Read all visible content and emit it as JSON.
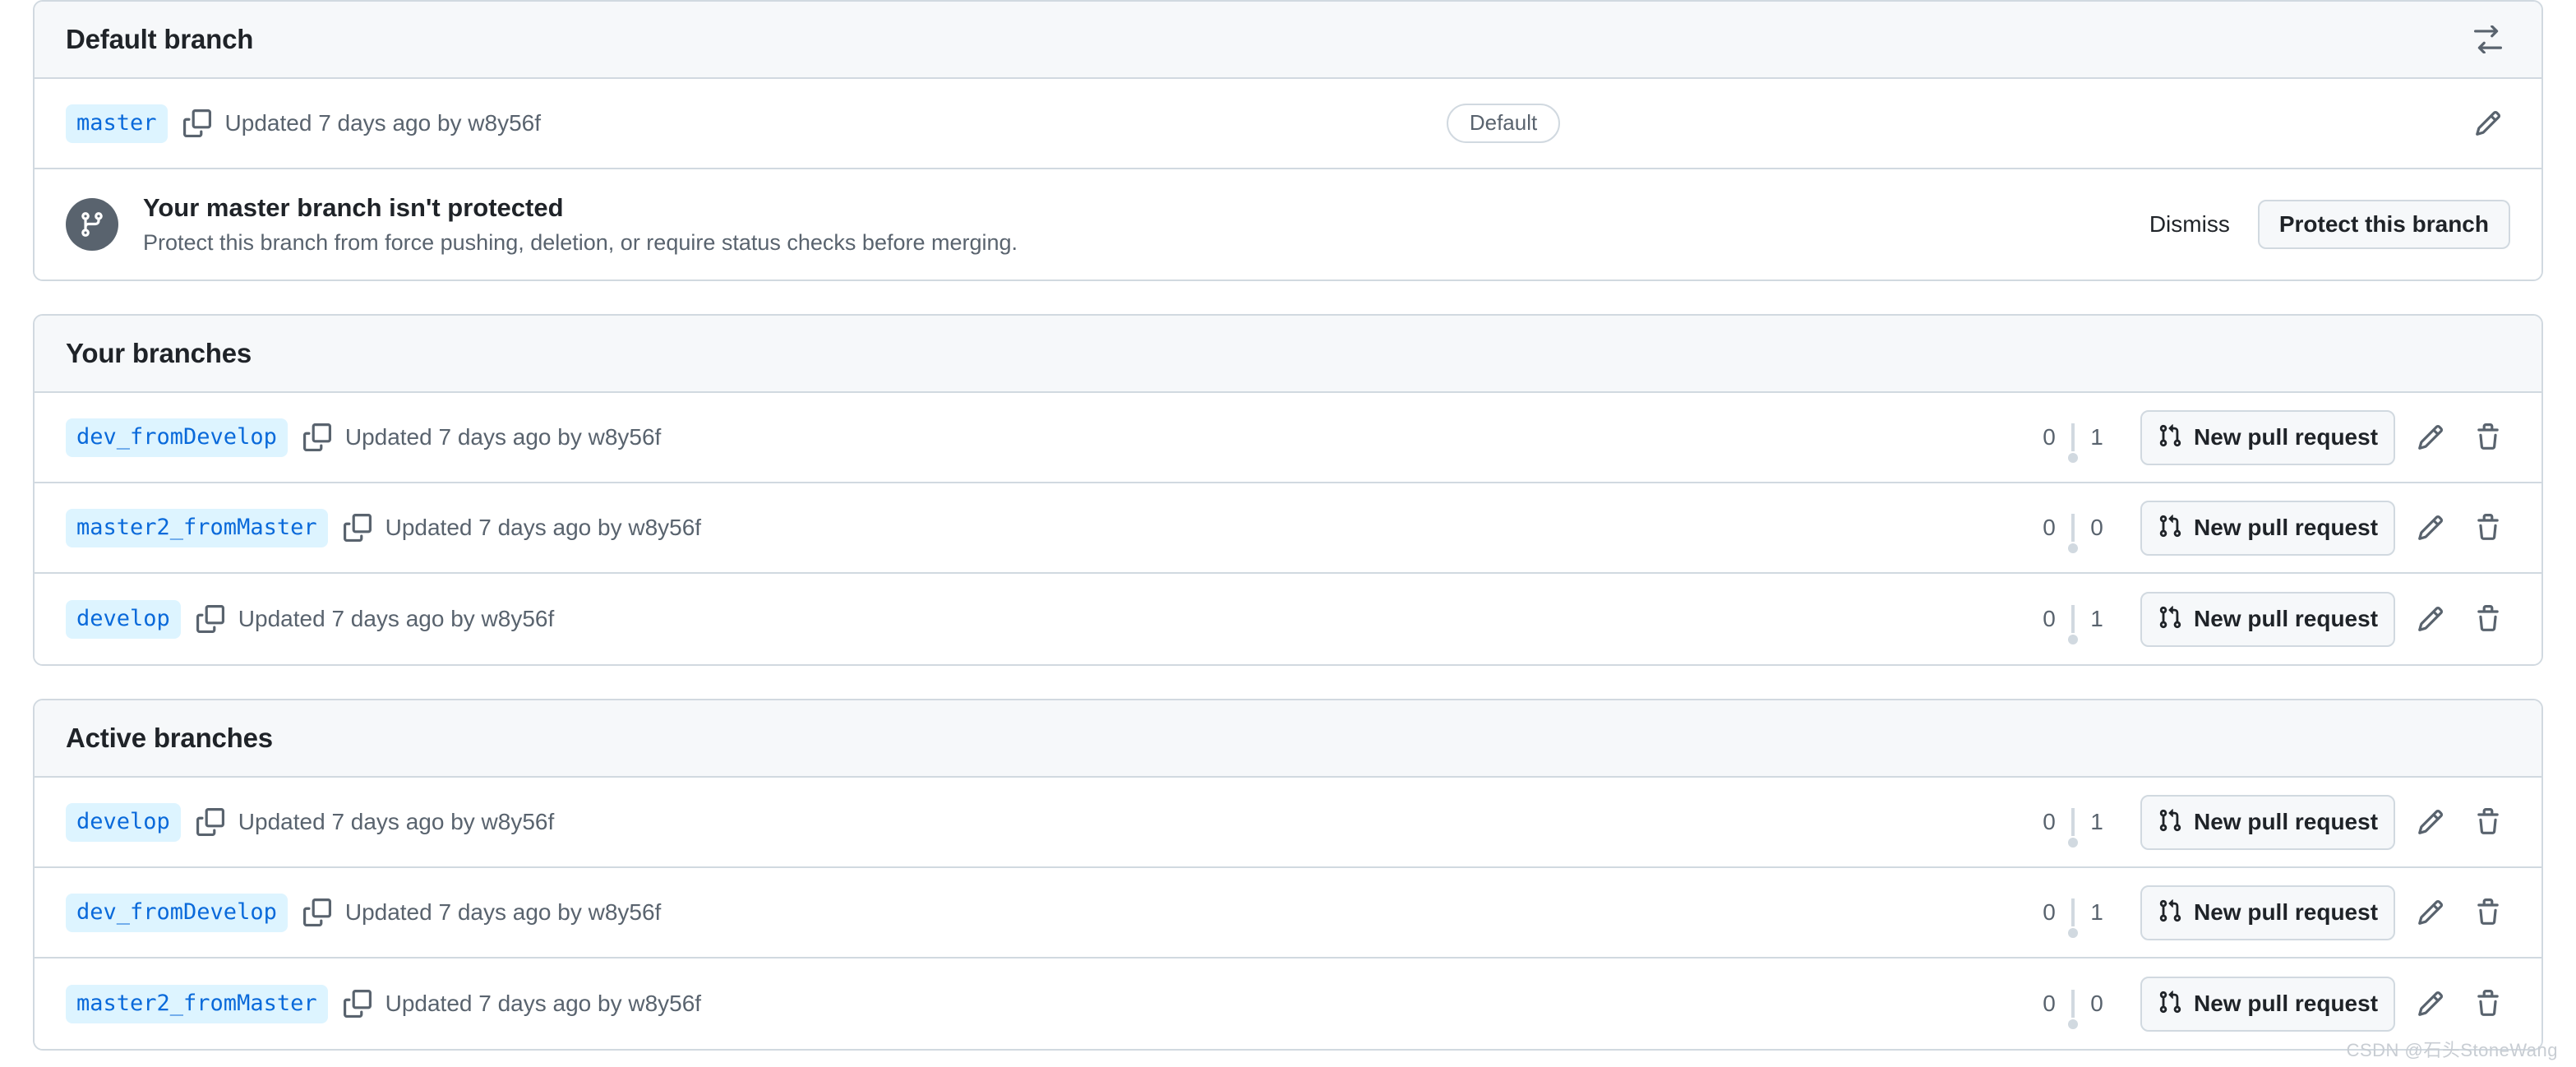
{
  "sections": [
    {
      "id": "default-branch",
      "title": "Default branch",
      "header_icon": "arrow-switch-icon",
      "rows": [
        {
          "branch": "master",
          "copy_icon": "copy-icon",
          "meta": "Updated 7 days ago by w8y56f",
          "badge": "Default",
          "edit_icon": "pencil-icon"
        }
      ],
      "banner": {
        "icon": "git-branch-icon",
        "title": "Your master branch isn't protected",
        "subtitle": "Protect this branch from force pushing, deletion, or require status checks before merging.",
        "dismiss_label": "Dismiss",
        "action_label": "Protect this branch"
      }
    },
    {
      "id": "your-branches",
      "title": "Your branches",
      "rows": [
        {
          "branch": "dev_fromDevelop",
          "copy_icon": "copy-icon",
          "meta": "Updated 7 days ago by w8y56f",
          "ahead": "0",
          "behind": "1",
          "pr_label": "New pull request",
          "pr_icon": "git-pull-request-icon",
          "edit_icon": "pencil-icon",
          "delete_icon": "trash-icon"
        },
        {
          "branch": "master2_fromMaster",
          "copy_icon": "copy-icon",
          "meta": "Updated 7 days ago by w8y56f",
          "ahead": "0",
          "behind": "0",
          "pr_label": "New pull request",
          "pr_icon": "git-pull-request-icon",
          "edit_icon": "pencil-icon",
          "delete_icon": "trash-icon"
        },
        {
          "branch": "develop",
          "copy_icon": "copy-icon",
          "meta": "Updated 7 days ago by w8y56f",
          "ahead": "0",
          "behind": "1",
          "pr_label": "New pull request",
          "pr_icon": "git-pull-request-icon",
          "edit_icon": "pencil-icon",
          "delete_icon": "trash-icon"
        }
      ]
    },
    {
      "id": "active-branches",
      "title": "Active branches",
      "rows": [
        {
          "branch": "develop",
          "copy_icon": "copy-icon",
          "meta": "Updated 7 days ago by w8y56f",
          "ahead": "0",
          "behind": "1",
          "pr_label": "New pull request",
          "pr_icon": "git-pull-request-icon",
          "edit_icon": "pencil-icon",
          "delete_icon": "trash-icon"
        },
        {
          "branch": "dev_fromDevelop",
          "copy_icon": "copy-icon",
          "meta": "Updated 7 days ago by w8y56f",
          "ahead": "0",
          "behind": "1",
          "pr_label": "New pull request",
          "pr_icon": "git-pull-request-icon",
          "edit_icon": "pencil-icon",
          "delete_icon": "trash-icon"
        },
        {
          "branch": "master2_fromMaster",
          "copy_icon": "copy-icon",
          "meta": "Updated 7 days ago by w8y56f",
          "ahead": "0",
          "behind": "0",
          "pr_label": "New pull request",
          "pr_icon": "git-pull-request-icon",
          "edit_icon": "pencil-icon",
          "delete_icon": "trash-icon"
        }
      ]
    }
  ],
  "watermark": "CSDN @石头StoneWang",
  "colors": {
    "chip_bg": "#ddf4ff",
    "chip_text": "#0969da",
    "border": "#d1d9e0",
    "header_bg": "#f6f8fa",
    "muted_text": "#59636e",
    "text": "#1f2328"
  }
}
